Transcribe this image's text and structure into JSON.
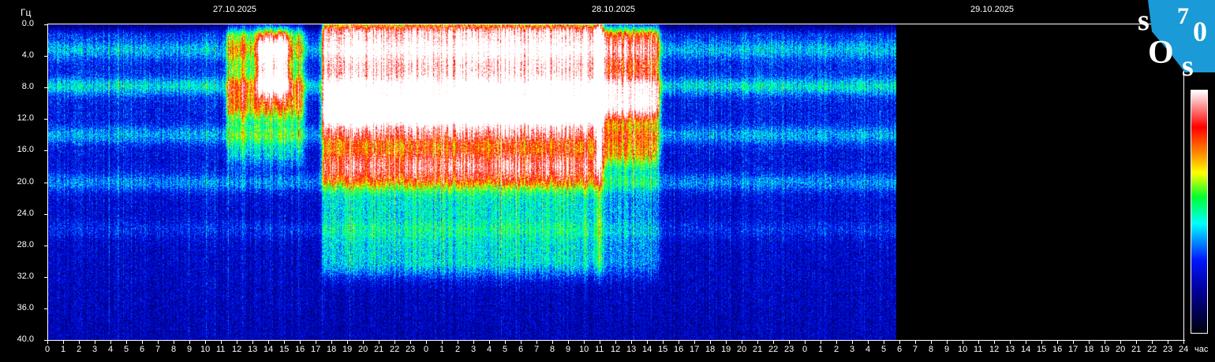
{
  "chart_data": {
    "type": "heatmap",
    "y_unit_label": "Гц",
    "x_unit_label": "час",
    "date_labels": [
      "27.10.2025",
      "28.10.2025",
      "29.10.2025"
    ],
    "ylim": [
      0,
      40
    ],
    "y_ticks": [
      "0.0",
      "4.0",
      "8.0",
      "12.0",
      "16.0",
      "20.0",
      "24.0",
      "28.0",
      "32.0",
      "36.0",
      "40.0"
    ],
    "x_hours_total": 72,
    "x_tick_labels": [
      "0",
      "1",
      "2",
      "3",
      "4",
      "5",
      "6",
      "7",
      "8",
      "9",
      "10",
      "11",
      "12",
      "13",
      "14",
      "15",
      "16",
      "17",
      "18",
      "19",
      "20",
      "21",
      "22",
      "23",
      "0",
      "1",
      "2",
      "3",
      "4",
      "5",
      "6",
      "7",
      "8",
      "9",
      "10",
      "11",
      "12",
      "13",
      "14",
      "15",
      "16",
      "17",
      "18",
      "19",
      "20",
      "21",
      "22",
      "23",
      "0",
      "1",
      "2",
      "3",
      "4",
      "5",
      "6",
      "7",
      "8",
      "9",
      "10",
      "11",
      "12",
      "13",
      "14",
      "15",
      "16",
      "17",
      "18",
      "19",
      "20",
      "21",
      "22",
      "23",
      "24"
    ],
    "data_end_hour": 53.7,
    "colormap": [
      "#000010",
      "#0000a0",
      "#0018ff",
      "#00ffff",
      "#00ff30",
      "#ffff00",
      "#ff8000",
      "#ff0000",
      "#ffffff"
    ],
    "resonance_lines_hz": [
      {
        "f": 3.2,
        "amp": 0.12
      },
      {
        "f": 7.8,
        "amp": 0.17
      },
      {
        "f": 14.0,
        "amp": 0.13
      },
      {
        "f": 20.0,
        "amp": 0.12
      },
      {
        "f": 26.0,
        "amp": 0.05
      }
    ],
    "intensity_regions": [
      {
        "hours": [
          17.6,
          34.9
        ],
        "hz": [
          1,
          11
        ],
        "level": 0.75
      },
      {
        "hours": [
          17.6,
          34.9
        ],
        "hz": [
          11,
          18
        ],
        "level": 0.45
      },
      {
        "hours": [
          17.6,
          34.9
        ],
        "hz": [
          18,
          30
        ],
        "level": 0.22
      },
      {
        "hours": [
          35.0,
          38.5
        ],
        "hz": [
          2,
          10
        ],
        "level": 0.55
      },
      {
        "hours": [
          35.0,
          38.5
        ],
        "hz": [
          10,
          16
        ],
        "level": 0.32
      },
      {
        "hours": [
          35.0,
          38.5
        ],
        "hz": [
          16,
          30
        ],
        "level": 0.14
      },
      {
        "hours": [
          11.5,
          16.0
        ],
        "hz": [
          2,
          10
        ],
        "level": 0.3
      },
      {
        "hours": [
          11.5,
          16.0
        ],
        "hz": [
          10,
          16
        ],
        "level": 0.18
      },
      {
        "hours": [
          13.5,
          15.0
        ],
        "hz": [
          3,
          7
        ],
        "level": 0.55
      }
    ],
    "logo": "SOS70",
    "logo_color": "#1a9ad6"
  }
}
